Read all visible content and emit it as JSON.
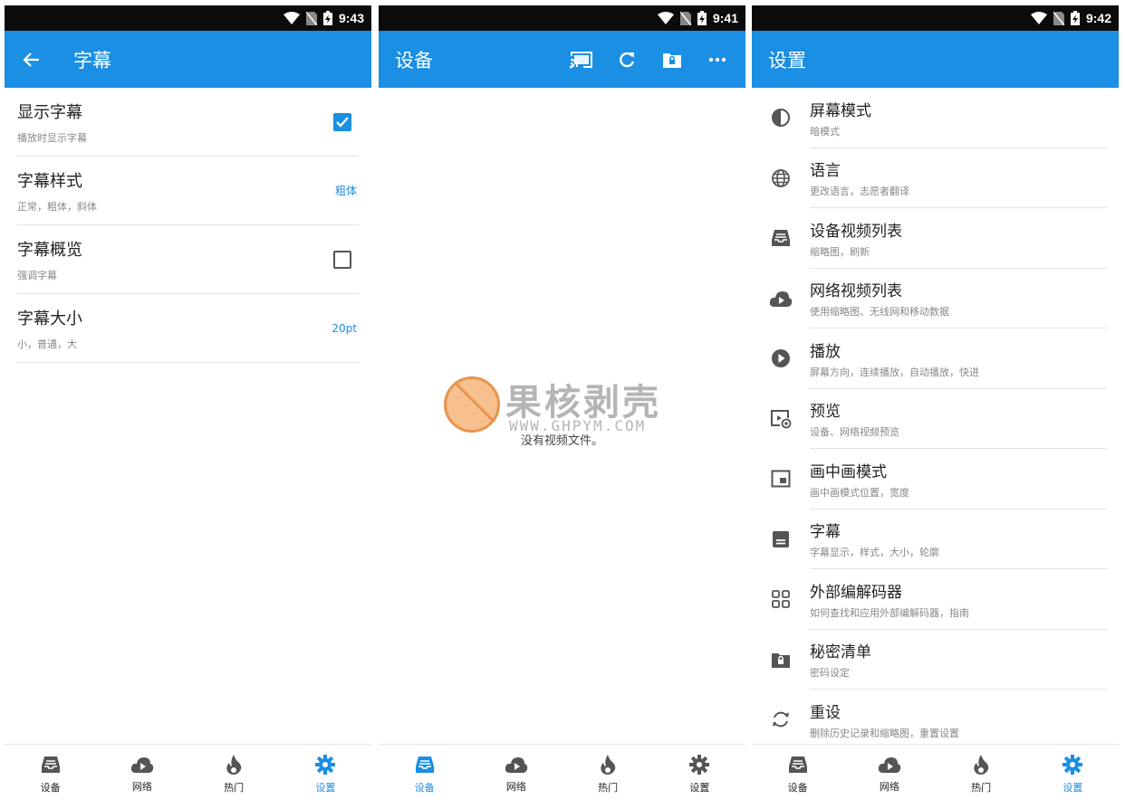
{
  "screens": {
    "subtitle": {
      "time": "9:43",
      "title": "字幕",
      "rows": [
        {
          "title": "显示字幕",
          "desc": "播放时显示字幕"
        },
        {
          "title": "字幕样式",
          "desc": "正常，粗体，斜体",
          "value": "粗体"
        },
        {
          "title": "字幕概览",
          "desc": "强调字幕"
        },
        {
          "title": "字幕大小",
          "desc": "小，普通，大",
          "value": "20pt"
        }
      ],
      "show_subtitle_checked": true,
      "overview_checked": false
    },
    "device": {
      "time": "9:41",
      "title": "设备",
      "empty_text": "没有视频文件。",
      "actions": [
        "cast-icon",
        "refresh-icon",
        "lock-folder-icon",
        "more-icon"
      ]
    },
    "settings": {
      "time": "9:42",
      "title": "设置",
      "rows": [
        {
          "icon": "contrast-icon",
          "title": "屏幕模式",
          "desc": "暗模式"
        },
        {
          "icon": "globe-icon",
          "title": "语言",
          "desc": "更改语言，志愿者翻译"
        },
        {
          "icon": "inbox-icon",
          "title": "设备视频列表",
          "desc": "缩略图，刷新"
        },
        {
          "icon": "cloud-play-icon",
          "title": "网络视频列表",
          "desc": "使用缩略图、无线网和移动数据"
        },
        {
          "icon": "play-circle-icon",
          "title": "播放",
          "desc": "屏幕方向，连续播放，自动播放，快进"
        },
        {
          "icon": "preview-icon",
          "title": "预览",
          "desc": "设备、网络视频预览"
        },
        {
          "icon": "pip-icon",
          "title": "画中画模式",
          "desc": "画中画模式位置，宽度"
        },
        {
          "icon": "subtitles-icon",
          "title": "字幕",
          "desc": "字幕显示，样式，大小，轮廓"
        },
        {
          "icon": "codec-icon",
          "title": "外部编解码器",
          "desc": "如何查找和应用外部编解码器，指南"
        },
        {
          "icon": "lock-folder-icon",
          "title": "秘密清单",
          "desc": "密码设定"
        },
        {
          "icon": "reset-icon",
          "title": "重设",
          "desc": "删除历史记录和缩略图，重置设置"
        }
      ]
    }
  },
  "nav": {
    "tabs": [
      "设备",
      "网络",
      "热门",
      "设置"
    ]
  },
  "watermark": {
    "brand": "果核剥壳",
    "url": "WWW.GHPYM.COM"
  },
  "colors": {
    "accent": "#1a8fe3",
    "statusbar": "#0b0b0b",
    "icon_gray": "#555555"
  }
}
